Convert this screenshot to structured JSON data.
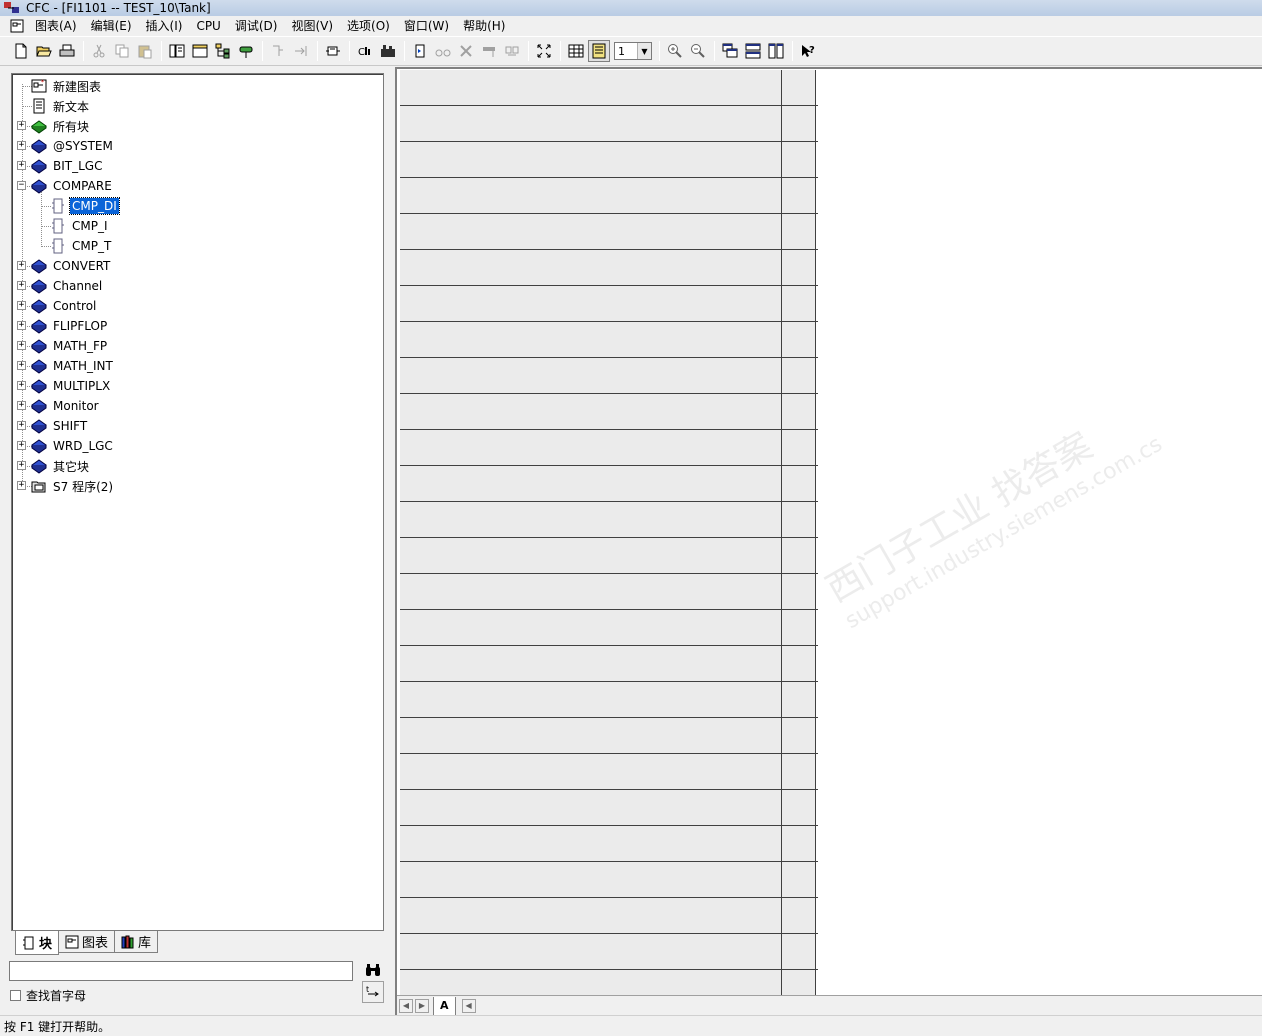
{
  "window": {
    "title": "CFC - [FI1101 -- TEST_10\\Tank]"
  },
  "menu": {
    "items": [
      "图表(A)",
      "编辑(E)",
      "插入(I)",
      "CPU",
      "调试(D)",
      "视图(V)",
      "选项(O)",
      "窗口(W)",
      "帮助(H)"
    ]
  },
  "toolbar": {
    "zoom_value": "1"
  },
  "tree": {
    "items": [
      {
        "label": "新建图表",
        "icon": "new-chart-icon",
        "level": 0,
        "expander": ""
      },
      {
        "label": "新文本",
        "icon": "new-text-icon",
        "level": 0,
        "expander": ""
      },
      {
        "label": "所有块",
        "icon": "green-library-icon",
        "level": 0,
        "expander": "+"
      },
      {
        "label": "@SYSTEM",
        "icon": "blue-library-icon",
        "level": 0,
        "expander": "+"
      },
      {
        "label": "BIT_LGC",
        "icon": "blue-library-icon",
        "level": 0,
        "expander": "+"
      },
      {
        "label": "COMPARE",
        "icon": "blue-library-icon",
        "level": 0,
        "expander": "-"
      },
      {
        "label": "CMP_DI",
        "icon": "block-icon",
        "level": 1,
        "expander": "",
        "selected": true
      },
      {
        "label": "CMP_I",
        "icon": "block-icon",
        "level": 1,
        "expander": ""
      },
      {
        "label": "CMP_T",
        "icon": "block-icon",
        "level": 1,
        "expander": ""
      },
      {
        "label": "CONVERT",
        "icon": "blue-library-icon",
        "level": 0,
        "expander": "+"
      },
      {
        "label": "Channel",
        "icon": "blue-library-icon",
        "level": 0,
        "expander": "+"
      },
      {
        "label": "Control",
        "icon": "blue-library-icon",
        "level": 0,
        "expander": "+"
      },
      {
        "label": "FLIPFLOP",
        "icon": "blue-library-icon",
        "level": 0,
        "expander": "+"
      },
      {
        "label": "MATH_FP",
        "icon": "blue-library-icon",
        "level": 0,
        "expander": "+"
      },
      {
        "label": "MATH_INT",
        "icon": "blue-library-icon",
        "level": 0,
        "expander": "+"
      },
      {
        "label": "MULTIPLX",
        "icon": "blue-library-icon",
        "level": 0,
        "expander": "+"
      },
      {
        "label": "Monitor",
        "icon": "blue-library-icon",
        "level": 0,
        "expander": "+"
      },
      {
        "label": "SHIFT",
        "icon": "blue-library-icon",
        "level": 0,
        "expander": "+"
      },
      {
        "label": "WRD_LGC",
        "icon": "blue-library-icon",
        "level": 0,
        "expander": "+"
      },
      {
        "label": "其它块",
        "icon": "blue-library-icon",
        "level": 0,
        "expander": "+"
      },
      {
        "label": "S7 程序(2)",
        "icon": "s7-program-icon",
        "level": 0,
        "expander": "+"
      }
    ]
  },
  "tabs": {
    "blocks": "块",
    "charts": "图表",
    "library": "库"
  },
  "search": {
    "value": "",
    "initials_label": "查找首字母"
  },
  "sheet": {
    "tab_label": "A"
  },
  "statusbar": {
    "text": "按 F1 键打开帮助。"
  },
  "watermark": {
    "line1": "西门子工业   找答案",
    "line2": "support.industry.siemens.com.cs"
  }
}
